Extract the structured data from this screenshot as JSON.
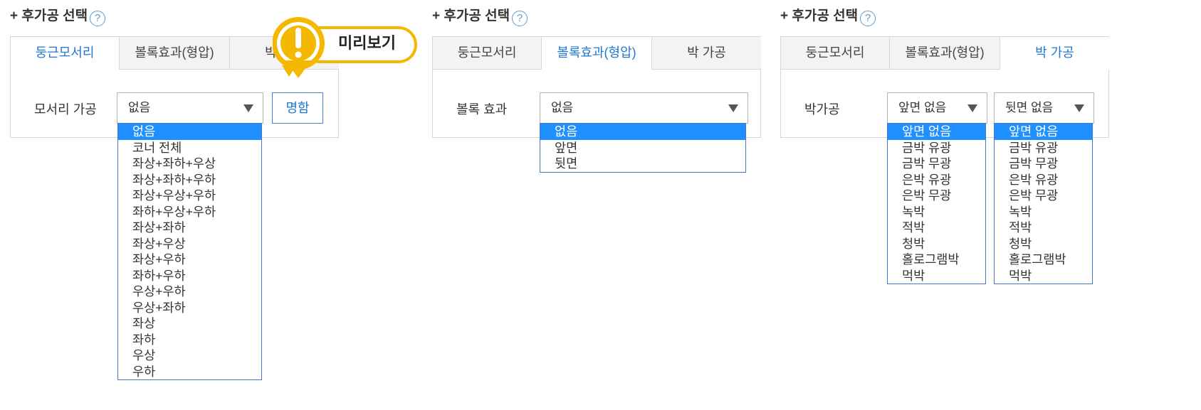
{
  "panels": [
    {
      "title": "+ 후가공 선택",
      "help": "?",
      "tabs": [
        "둥근모서리",
        "볼록효과(형압)",
        "박 가공"
      ],
      "active_tab": 0,
      "row_label": "모서리 가공",
      "select_value": "없음",
      "button_label": "명함",
      "options": [
        "없음",
        "코너 전체",
        "좌상+좌하+우상",
        "좌상+좌하+우하",
        "좌상+우상+우하",
        "좌하+우상+우하",
        "좌상+좌하",
        "좌상+우상",
        "좌상+우하",
        "좌하+우하",
        "우상+우하",
        "우상+좌하",
        "좌상",
        "좌하",
        "우상",
        "우하"
      ],
      "selected_option": 0
    },
    {
      "title": "+ 후가공 선택",
      "help": "?",
      "tabs": [
        "둥근모서리",
        "볼록효과(형압)",
        "박 가공"
      ],
      "active_tab": 1,
      "row_label": "볼록 효과",
      "select_value": "없음",
      "options": [
        "없음",
        "앞면",
        "뒷면"
      ],
      "selected_option": 0
    },
    {
      "title": "+ 후가공 선택",
      "help": "?",
      "tabs": [
        "둥근모서리",
        "볼록효과(형압)",
        "박 가공"
      ],
      "active_tab": 2,
      "row_label": "박가공",
      "select_front_value": "앞면 없음",
      "select_back_value": "뒷면 없음",
      "front_options": [
        "앞면 없음",
        "금박 유광",
        "금박 무광",
        "은박 유광",
        "은박 무광",
        "녹박",
        "적박",
        "청박",
        "홀로그램박",
        "먹박"
      ],
      "back_options": [
        "앞면 없음",
        "금박 유광",
        "금박 무광",
        "은박 유광",
        "은박 무광",
        "녹박",
        "적박",
        "청박",
        "홀로그램박",
        "먹박"
      ],
      "selected_option": 0
    }
  ],
  "preview_badge": {
    "label": "미리보기",
    "icon": "exclamation-icon",
    "color": "#f5b800"
  },
  "colors": {
    "accent": "#1e78d2",
    "selected_bg": "#1e90ff",
    "dropdown_border": "#4a74c7"
  }
}
